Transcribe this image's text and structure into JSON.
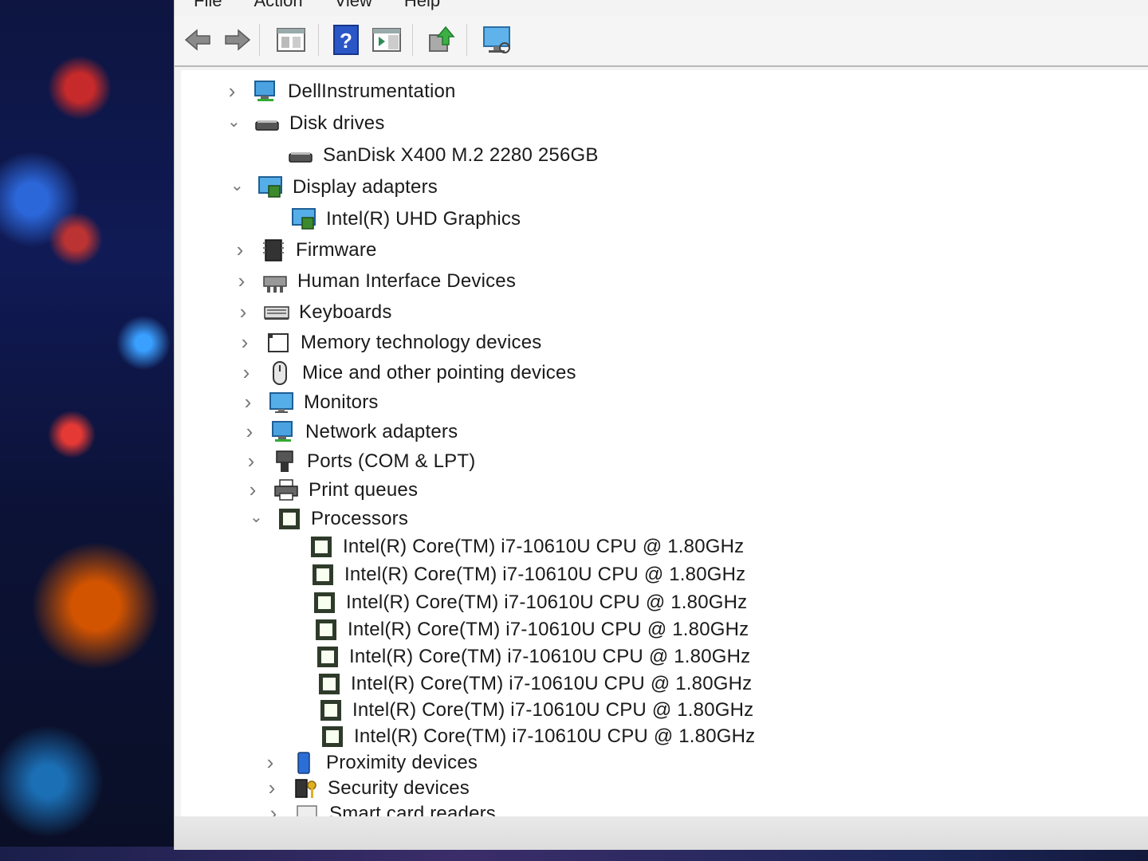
{
  "menu": [
    "File",
    "Action",
    "View",
    "Help"
  ],
  "toolbar": {
    "buttons": [
      "back-arrow-icon",
      "forward-arrow-icon",
      "properties-icon",
      "help-icon",
      "action-pane-icon",
      "update-driver-icon",
      "scan-monitor-icon"
    ]
  },
  "tree": {
    "dell": "DellInstrumentation",
    "disk_drives": "Disk drives",
    "disk_child": "SanDisk X400 M.2 2280 256GB",
    "display_adapters": "Display adapters",
    "display_child": "Intel(R) UHD Graphics",
    "firmware": "Firmware",
    "hid": "Human Interface Devices",
    "keyboards": "Keyboards",
    "memory": "Memory technology devices",
    "mice": "Mice and other pointing devices",
    "monitors": "Monitors",
    "network": "Network adapters",
    "ports": "Ports (COM & LPT)",
    "print": "Print queues",
    "processors": "Processors",
    "cpus": [
      "Intel(R) Core(TM) i7-10610U CPU @ 1.80GHz",
      "Intel(R) Core(TM) i7-10610U CPU @ 1.80GHz",
      "Intel(R) Core(TM) i7-10610U CPU @ 1.80GHz",
      "Intel(R) Core(TM) i7-10610U CPU @ 1.80GHz",
      "Intel(R) Core(TM) i7-10610U CPU @ 1.80GHz",
      "Intel(R) Core(TM) i7-10610U CPU @ 1.80GHz",
      "Intel(R) Core(TM) i7-10610U CPU @ 1.80GHz",
      "Intel(R) Core(TM) i7-10610U CPU @ 1.80GHz"
    ],
    "proximity": "Proximity devices",
    "security": "Security devices",
    "smartcard": "Smart card readers"
  },
  "colors": {
    "window_bg": "#ffffff",
    "toolbar_bg": "#f5f5f5",
    "text": "#1a1a1a",
    "cpu_icon": "#2f3b2a"
  }
}
